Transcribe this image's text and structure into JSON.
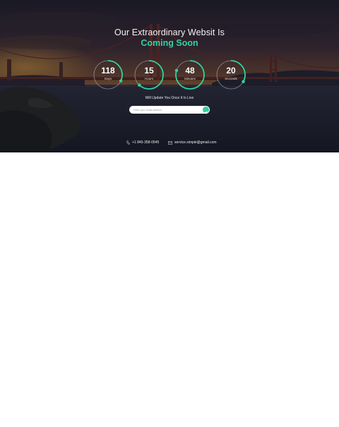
{
  "hero": {
    "headline": "Our Extraordinary Websit Is",
    "subhead": "Coming Soon",
    "accent_color": "#2fd3a2"
  },
  "countdown": [
    {
      "value": "118",
      "unit": "Days",
      "progress": 0.32
    },
    {
      "value": "15",
      "unit": "Hours",
      "progress": 0.62
    },
    {
      "value": "48",
      "unit": "Minutes",
      "progress": 0.8
    },
    {
      "value": "20",
      "unit": "Seconds",
      "progress": 0.33
    }
  ],
  "notice": "Will Update You Once It Is Live",
  "subscribe": {
    "placeholder": "Enter your email address",
    "button_icon": "send-icon"
  },
  "contact": {
    "phone_icon": "phone-icon",
    "phone": "+1 845-358-0545",
    "email_icon": "mail-icon",
    "email": "service.simple@gmail.com"
  }
}
